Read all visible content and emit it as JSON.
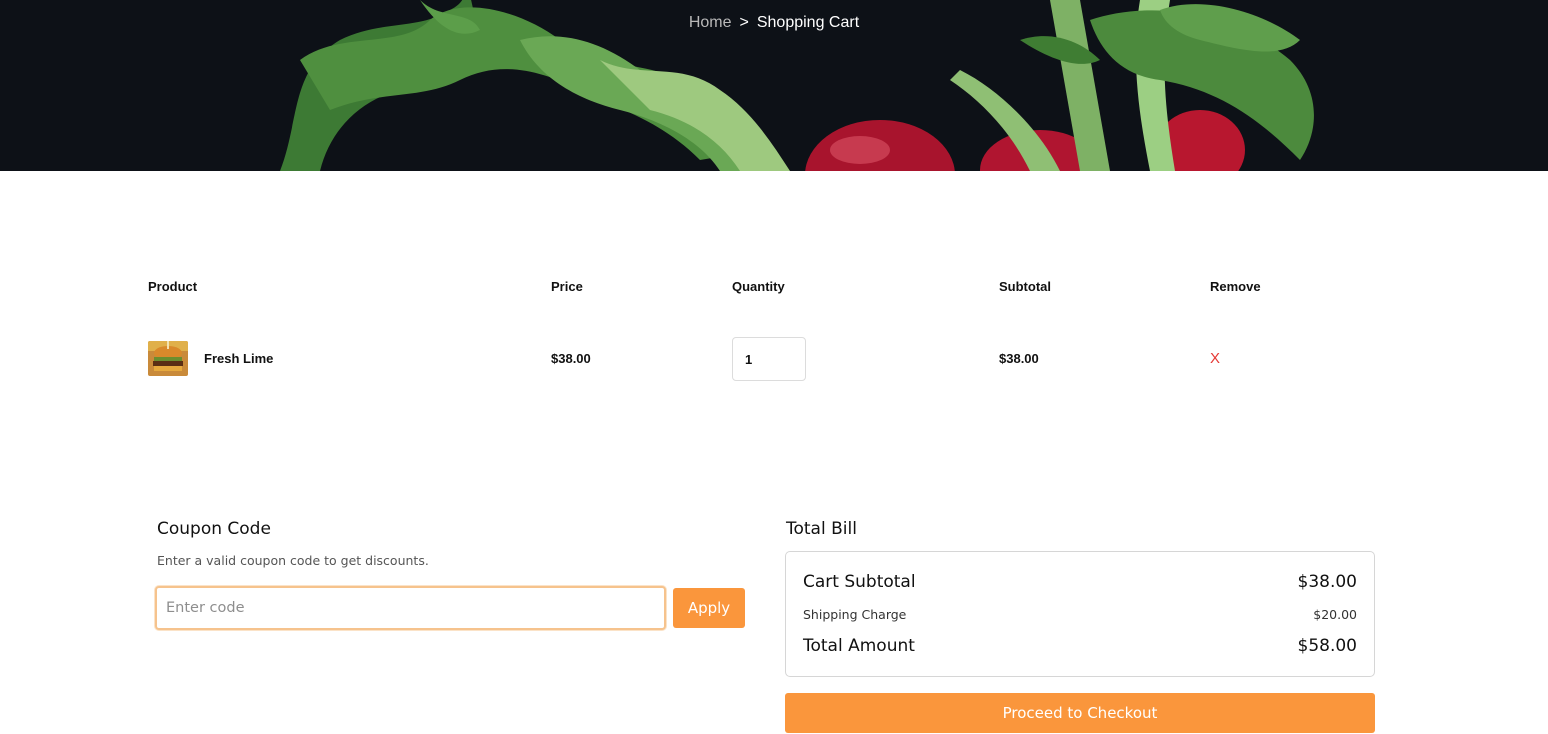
{
  "breadcrumb": {
    "home": "Home",
    "separator": ">",
    "current": "Shopping Cart"
  },
  "table": {
    "headers": {
      "product": "Product",
      "price": "Price",
      "quantity": "Quantity",
      "subtotal": "Subtotal",
      "remove": "Remove"
    },
    "rows": [
      {
        "name": "Fresh Lime",
        "price": "$38.00",
        "quantity": "1",
        "subtotal": "$38.00",
        "remove": "X"
      }
    ]
  },
  "coupon": {
    "title": "Coupon Code",
    "subtitle": "Enter a valid coupon code to get discounts.",
    "placeholder": "Enter code",
    "apply_label": "Apply"
  },
  "bill": {
    "title": "Total Bill",
    "cart_subtotal_label": "Cart Subtotal",
    "cart_subtotal_value": "$38.00",
    "shipping_label": "Shipping Charge",
    "shipping_value": "$20.00",
    "total_label": "Total Amount",
    "total_value": "$58.00",
    "checkout_label": "Proceed to Checkout"
  },
  "colors": {
    "accent": "#fa963c",
    "remove": "#e53935",
    "banner_bg": "#0d1117"
  }
}
